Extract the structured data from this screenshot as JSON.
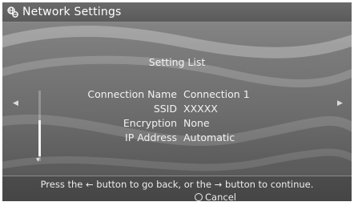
{
  "header": {
    "title": "Network Settings",
    "icon": "network-globe-icon"
  },
  "list": {
    "title": "Setting List",
    "rows": [
      {
        "label": "Connection Name",
        "value": "Connection 1"
      },
      {
        "label": "SSID",
        "value": "XXXXX"
      },
      {
        "label": "Encryption",
        "value": "None"
      },
      {
        "label": "IP Address",
        "value": "Automatic"
      }
    ]
  },
  "footer": {
    "instruction": "Press the ← button to go back, or the → button to continue.",
    "cancel_label": "Cancel"
  },
  "colors": {
    "background": "#6d6d6d",
    "text": "#ffffff"
  }
}
